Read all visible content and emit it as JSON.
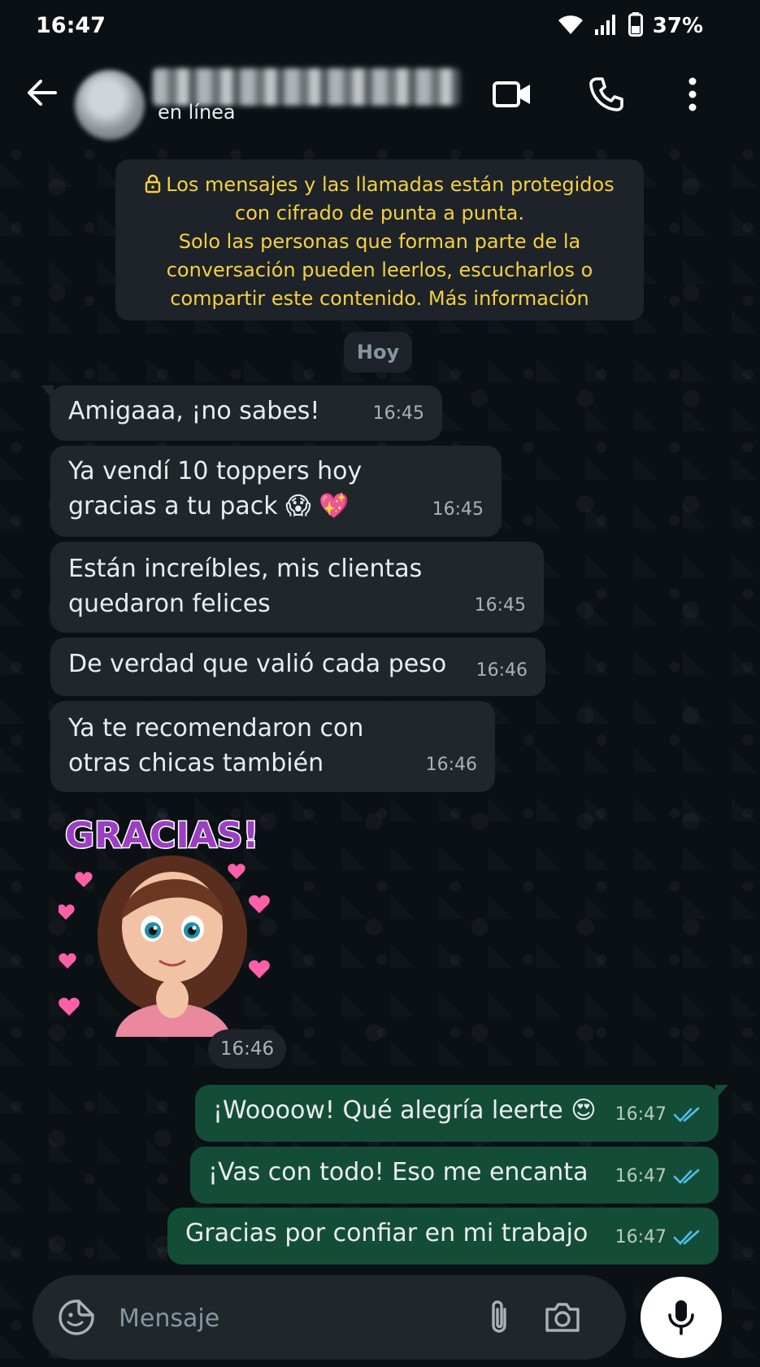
{
  "status_bar": {
    "time": "16:47",
    "battery": "37%"
  },
  "header": {
    "contact_status": "en línea"
  },
  "encryption_notice": {
    "lines": [
      "Los mensajes y las llamadas están protegidos",
      "con cifrado de punta a punta.",
      "Solo las personas que forman parte de la",
      "conversación pueden leerlos, escucharlos o",
      "compartir este contenido. Más información"
    ]
  },
  "date_divider": "Hoy",
  "messages": [
    {
      "direction": "in",
      "lines": [
        "Amigaaa, ¡no sabes!"
      ],
      "time": "16:45"
    },
    {
      "direction": "in",
      "lines": [
        "Ya vendí 10 toppers hoy",
        "gracias a tu pack 😱 💖"
      ],
      "time": "16:45"
    },
    {
      "direction": "in",
      "lines": [
        "Están increíbles, mis clientas",
        "quedaron felices"
      ],
      "time": "16:45"
    },
    {
      "direction": "in",
      "lines": [
        "De verdad que valió cada peso"
      ],
      "time": "16:46"
    },
    {
      "direction": "in",
      "lines": [
        "Ya te recomendaron con",
        "otras chicas también"
      ],
      "time": "16:46"
    },
    {
      "direction": "out",
      "lines": [
        "¡Woooow! Qué alegría leerte 😍"
      ],
      "time": "16:47"
    },
    {
      "direction": "out",
      "lines": [
        "¡Vas con todo! Eso me encanta"
      ],
      "time": "16:47"
    },
    {
      "direction": "out",
      "lines": [
        "Gracias por confiar en mi trabajo"
      ],
      "time": "16:47"
    }
  ],
  "sticker": {
    "text": "GRACIAS!",
    "time": "16:46"
  },
  "composer": {
    "placeholder": "Mensaje"
  },
  "colors": {
    "background": "#0b1014",
    "incoming_bubble": "#1f272b",
    "outgoing_bubble": "#144d37",
    "read_ticks": "#53bdeb",
    "notice_text": "#f5d043"
  },
  "icons": [
    "back-arrow-icon",
    "video-call-icon",
    "phone-icon",
    "more-vert-icon",
    "lock-icon",
    "wifi-icon",
    "signal-icon",
    "battery-icon",
    "sticker-icon",
    "attach-icon",
    "camera-icon",
    "mic-icon",
    "double-check-icon"
  ]
}
